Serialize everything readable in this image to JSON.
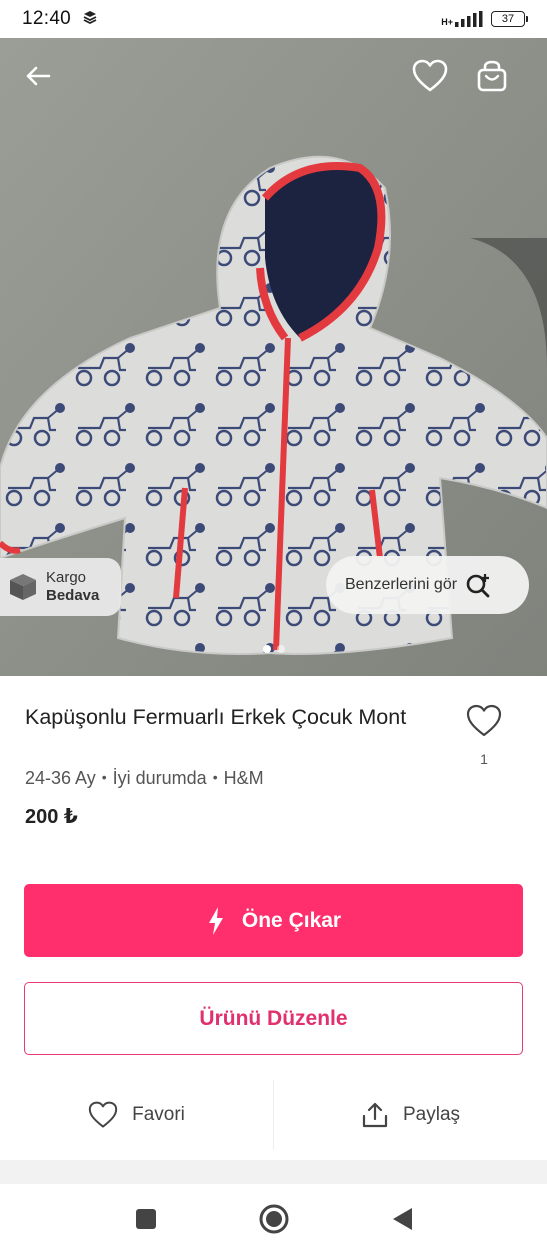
{
  "status_bar": {
    "time": "12:40",
    "network": "H+",
    "battery": "37"
  },
  "hero": {
    "back_icon": "arrow-left-icon",
    "favorite_icon": "heart-outline-icon",
    "bag_icon": "shopping-bag-icon",
    "kargo_line1": "Kargo",
    "kargo_line2": "Bedava",
    "similar_label": "Benzerlerini gör",
    "image_count": 2,
    "active_image": 1
  },
  "product": {
    "title": "Kapüşonlu Fermuarlı Erkek Çocuk Mont",
    "size": "24-36 Ay",
    "condition": "İyi durumda",
    "brand": "H&M",
    "price": "200 ₺",
    "like_count": "1"
  },
  "buttons": {
    "promote": "Öne Çıkar",
    "edit": "Ürünü Düzenle"
  },
  "actions": {
    "favorite": "Favori",
    "share": "Paylaş"
  },
  "colors": {
    "accent": "#ff2f6d",
    "outline": "#e83a73"
  }
}
